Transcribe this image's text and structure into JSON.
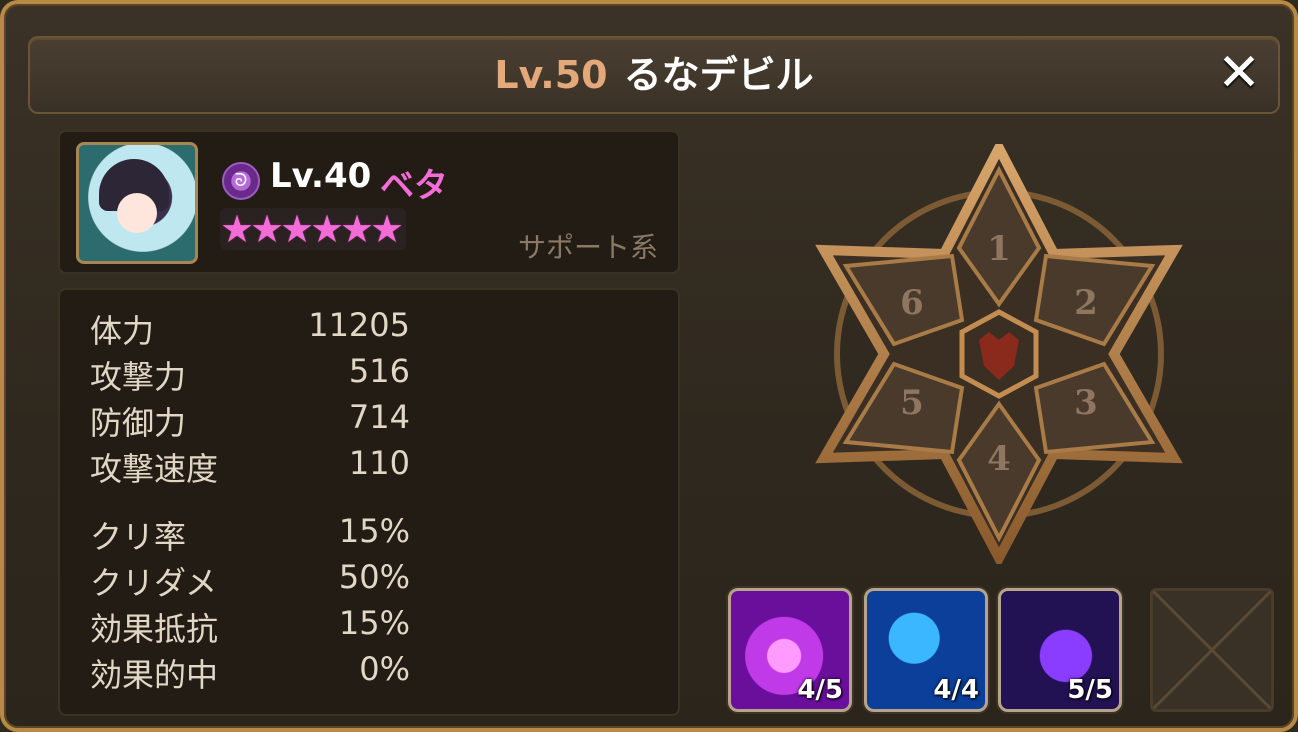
{
  "window": {
    "title_level": "Lv.50",
    "title_name": "るなデビル",
    "close_icon": "close-x-icon"
  },
  "monster": {
    "level": "Lv.40",
    "name": "ベタ",
    "element_icon": "dark-element-icon",
    "stars": 6,
    "type": "サポート系",
    "colors": {
      "name": "#f36cd7",
      "star": "#f36cd7",
      "title_level": "#e3a97a"
    }
  },
  "stats": [
    {
      "label": "体力",
      "value": "11205"
    },
    {
      "label": "攻撃力",
      "value": "516"
    },
    {
      "label": "防御力",
      "value": "714"
    },
    {
      "label": "攻撃速度",
      "value": "110"
    },
    {
      "label": "クリ率",
      "value": "15%"
    },
    {
      "label": "クリダメ",
      "value": "50%"
    },
    {
      "label": "効果抵抗",
      "value": "15%"
    },
    {
      "label": "効果的中",
      "value": "0%"
    }
  ],
  "rune_slots": [
    "1",
    "2",
    "3",
    "4",
    "5",
    "6"
  ],
  "rune_center_icon": "demon-skull-icon",
  "skills": [
    {
      "level": "4/5",
      "icon": "bubble-skill-icon"
    },
    {
      "level": "4/4",
      "icon": "silhouette-skill-icon"
    },
    {
      "level": "5/5",
      "icon": "aura-skill-icon"
    }
  ],
  "empty_skill_icon": "empty-slot-icon"
}
